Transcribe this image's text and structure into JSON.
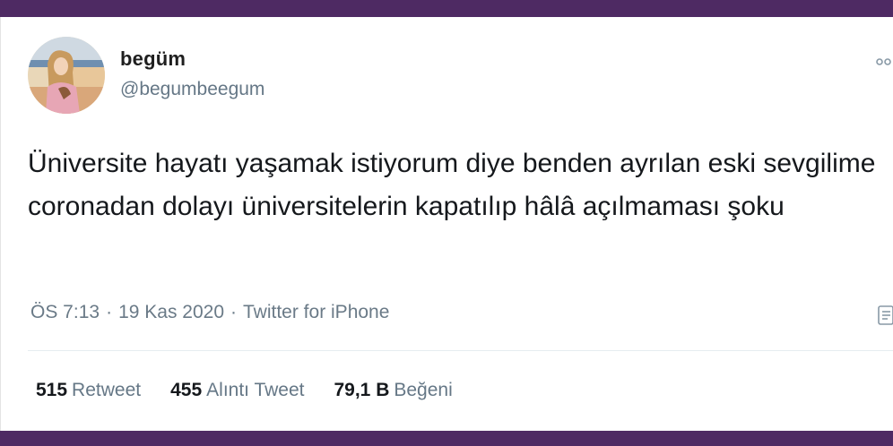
{
  "colors": {
    "frame": "#4e2a63",
    "text": "#15181c",
    "secondary": "#657786"
  },
  "tweet": {
    "author": {
      "display_name": "begüm",
      "handle": "@begumbeegum",
      "avatar_icon": "profile-photo"
    },
    "text": "Üniversite hayatı yaşamak istiyorum diye benden ayrılan eski sevgilime coronadan dolayı üniversitelerin kapatılıp hâlâ açılmaması şoku",
    "time": "ÖS 7:13",
    "separator": "·",
    "date": "19 Kas 2020",
    "source": "Twitter for iPhone",
    "stats": [
      {
        "count": "515",
        "label": "Retweet"
      },
      {
        "count": "455",
        "label": "Alıntı Tweet"
      },
      {
        "count": "79,1 B",
        "label": "Beğeni"
      }
    ]
  }
}
